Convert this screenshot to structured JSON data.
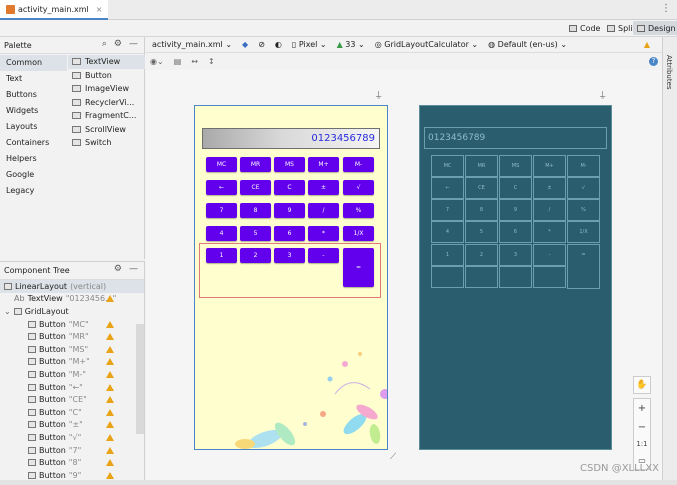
{
  "tab": {
    "filename": "activity_main.xml",
    "close": "×"
  },
  "modes": [
    "Code",
    "Split",
    "Design"
  ],
  "palette": {
    "title": "Palette",
    "categories": [
      "Common",
      "Text",
      "Buttons",
      "Widgets",
      "Layouts",
      "Containers",
      "Helpers",
      "Google",
      "Legacy"
    ],
    "widgets": [
      "TextView",
      "Button",
      "ImageView",
      "RecyclerVi...",
      "FragmentC...",
      "ScrollView",
      "Switch"
    ]
  },
  "toolbar": {
    "file": "activity_main.xml",
    "device": "Pixel",
    "api": "33",
    "theme": "GridLayoutCalculator",
    "locale": "Default (en-us)"
  },
  "component_tree": {
    "title": "Component Tree",
    "root": {
      "name": "LinearLayout",
      "hint": "(vertical)"
    },
    "textview": {
      "name": "TextView",
      "value": "\"0123456...\""
    },
    "grid": "GridLayout",
    "buttons": [
      "\"MC\"",
      "\"MR\"",
      "\"MS\"",
      "\"M+\"",
      "\"M-\"",
      "\"←\"",
      "\"CE\"",
      "\"C\"",
      "\"±\"",
      "\"√\"",
      "\"7\"",
      "\"8\"",
      "\"9\""
    ]
  },
  "calculator": {
    "display": "0123456789",
    "rows": [
      [
        "MC",
        "MR",
        "MS",
        "M+",
        "M-"
      ],
      [
        "←",
        "CE",
        "C",
        "±",
        "√"
      ],
      [
        "7",
        "8",
        "9",
        "/",
        "%"
      ],
      [
        "4",
        "5",
        "6",
        "*",
        "1/X"
      ],
      [
        "1",
        "2",
        "3",
        "-"
      ]
    ],
    "equals": "="
  },
  "attributes_label": "Attributes",
  "zoom": {
    "in": "+",
    "out": "−",
    "reset": "1:1"
  },
  "watermark": "CSDN @XLLLXX"
}
